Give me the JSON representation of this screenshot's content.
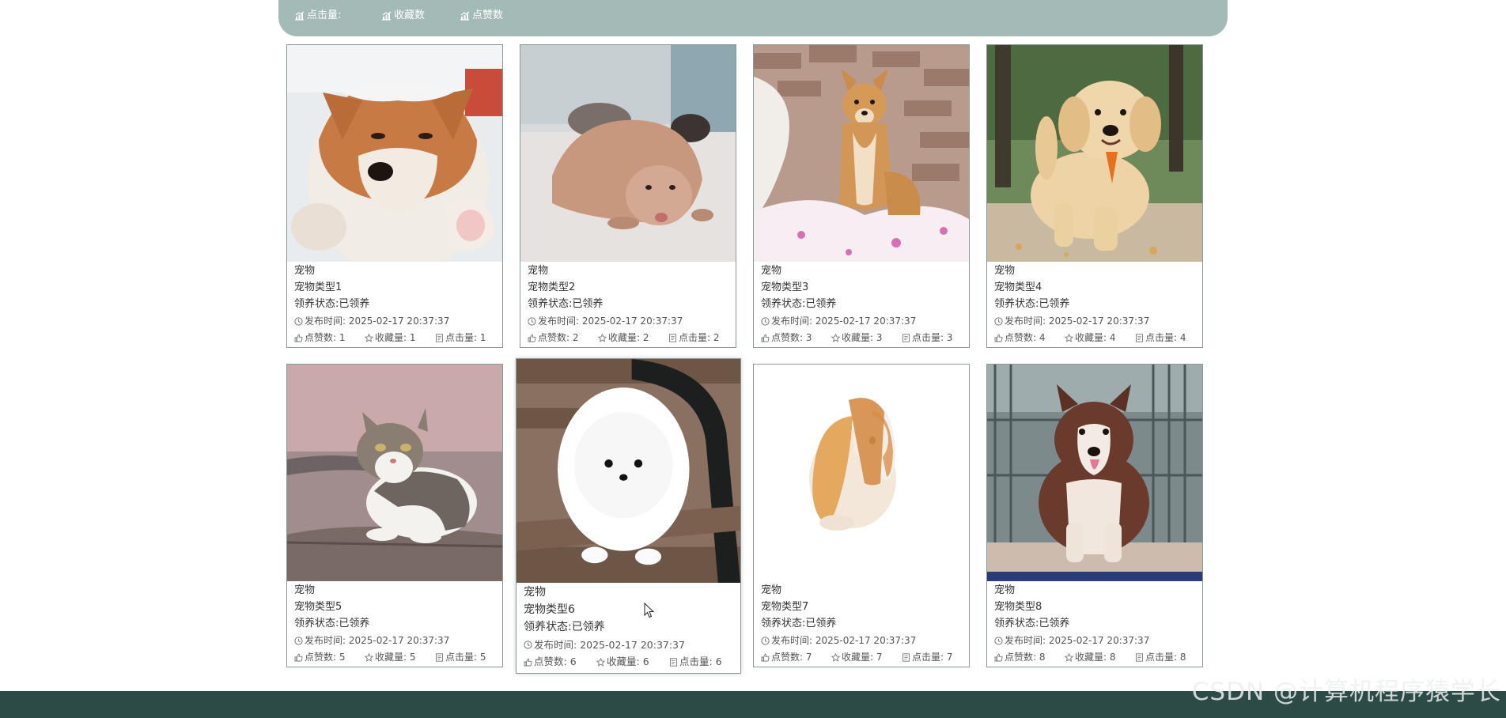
{
  "sort_bar": {
    "clicks_label": "点击量:",
    "collects_label": "收藏数",
    "likes_label": "点赞数"
  },
  "cards": [
    {
      "category": "宠物",
      "name": "宠物类型1",
      "status": "领养状态:已领养",
      "time_label": "发布时间:",
      "time": "2025-02-17 20:37:37",
      "likes_label": "点赞数:",
      "likes": "1",
      "collects_label": "收藏量:",
      "collects": "1",
      "clicks_label": "点击量:",
      "clicks": "1",
      "image": "shiba-dog-snow"
    },
    {
      "category": "宠物",
      "name": "宠物类型2",
      "status": "领养状态:已领养",
      "time_label": "发布时间:",
      "time": "2025-02-17 20:37:37",
      "likes_label": "点赞数:",
      "likes": "2",
      "collects_label": "收藏量:",
      "collects": "2",
      "clicks_label": "点击量:",
      "clicks": "2",
      "image": "ferret-lying"
    },
    {
      "category": "宠物",
      "name": "宠物类型3",
      "status": "领养状态:已领养",
      "time_label": "发布时间:",
      "time": "2025-02-17 20:37:37",
      "likes_label": "点赞数:",
      "likes": "3",
      "collects_label": "收藏量:",
      "collects": "3",
      "clicks_label": "点击量:",
      "clicks": "3",
      "image": "shiba-puppy-brick-wall"
    },
    {
      "category": "宠物",
      "name": "宠物类型4",
      "status": "领养状态:已领养",
      "time_label": "发布时间:",
      "time": "2025-02-17 20:37:37",
      "likes_label": "点赞数:",
      "likes": "4",
      "collects_label": "收藏量:",
      "collects": "4",
      "clicks_label": "点击量:",
      "clicks": "4",
      "image": "golden-retriever-puppy"
    },
    {
      "category": "宠物",
      "name": "宠物类型5",
      "status": "领养状态:已领养",
      "time_label": "发布时间:",
      "time": "2025-02-17 20:37:37",
      "likes_label": "点赞数:",
      "likes": "5",
      "collects_label": "收藏量:",
      "collects": "5",
      "clicks_label": "点击量:",
      "clicks": "5",
      "image": "tabby-cat"
    },
    {
      "category": "宠物",
      "name": "宠物类型6",
      "status": "领养状态:已领养",
      "time_label": "发布时间:",
      "time": "2025-02-17 20:37:37",
      "likes_label": "点赞数:",
      "likes": "6",
      "collects_label": "收藏量:",
      "collects": "6",
      "clicks_label": "点击量:",
      "clicks": "6",
      "image": "white-pomeranian"
    },
    {
      "category": "宠物",
      "name": "宠物类型7",
      "status": "领养状态:已领养",
      "time_label": "发布时间:",
      "time": "2025-02-17 20:37:37",
      "likes_label": "点赞数:",
      "likes": "7",
      "collects_label": "收藏量:",
      "collects": "7",
      "clicks_label": "点击量:",
      "clicks": "7",
      "image": "lop-rabbit"
    },
    {
      "category": "宠物",
      "name": "宠物类型8",
      "status": "领养状态:已领养",
      "time_label": "发布时间:",
      "time": "2025-02-17 20:37:37",
      "likes_label": "点赞数:",
      "likes": "8",
      "collects_label": "收藏量:",
      "collects": "8",
      "clicks_label": "点击量:",
      "clicks": "8",
      "image": "alaskan-malamute-puppy"
    }
  ],
  "watermark": "CSDN @计算机程序猿学长",
  "colors": {
    "sort_bar": "#a4bab7",
    "footer": "#2c4a46",
    "card_border": "#8a9a98"
  }
}
